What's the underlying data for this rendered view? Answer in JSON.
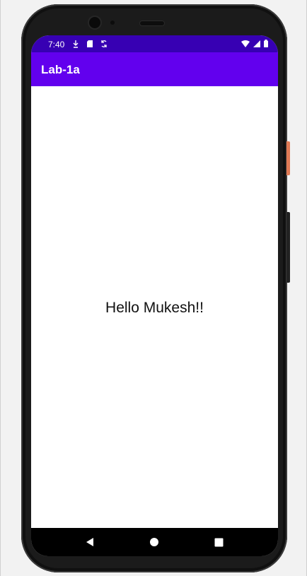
{
  "status_bar": {
    "time": "7:40",
    "left_icons": [
      "download-icon",
      "sd-card-icon",
      "sync-icon"
    ],
    "right_icons": [
      "wifi-icon",
      "cell-signal-icon",
      "battery-icon"
    ]
  },
  "app_bar": {
    "title": "Lab-1a"
  },
  "content": {
    "message": "Hello Mukesh!!"
  },
  "nav_bar": {
    "buttons": [
      "back-icon",
      "home-icon",
      "recents-icon"
    ]
  },
  "colors": {
    "status_bar_bg": "#3700B3",
    "app_bar_bg": "#6200EE",
    "content_bg": "#FFFFFF",
    "text": "#111111",
    "nav_bar_bg": "#000000",
    "device_frame": "#1b1b1b"
  }
}
